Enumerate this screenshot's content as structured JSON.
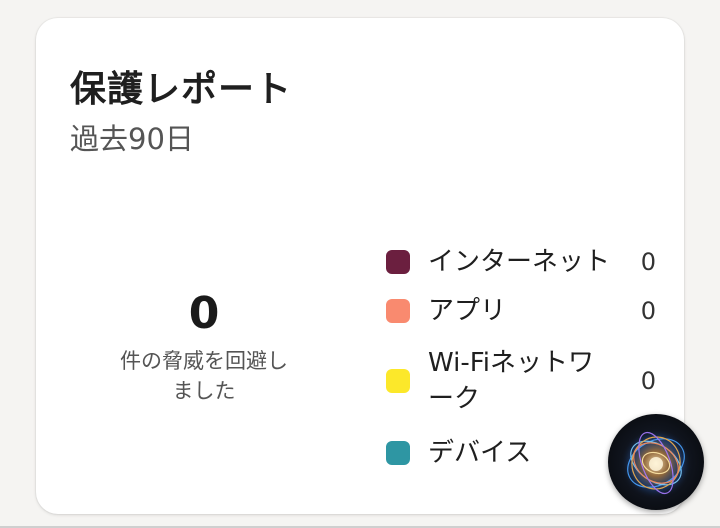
{
  "report": {
    "title": "保護レポート",
    "period": "過去90日",
    "summary": {
      "count": "0",
      "caption": "件の脅威を回避しました"
    },
    "legend": [
      {
        "label": "インターネット",
        "value": "0",
        "color": "#6b1f3f"
      },
      {
        "label": "アプリ",
        "value": "0",
        "color": "#f98a6f"
      },
      {
        "label": "Wi-Fiネットワーク",
        "value": "0",
        "color": "#fce82a"
      },
      {
        "label": "デバイス",
        "value": "",
        "color": "#2e96a3"
      }
    ]
  },
  "assistant": {
    "icon": "ai-assistant-orb-icon"
  }
}
